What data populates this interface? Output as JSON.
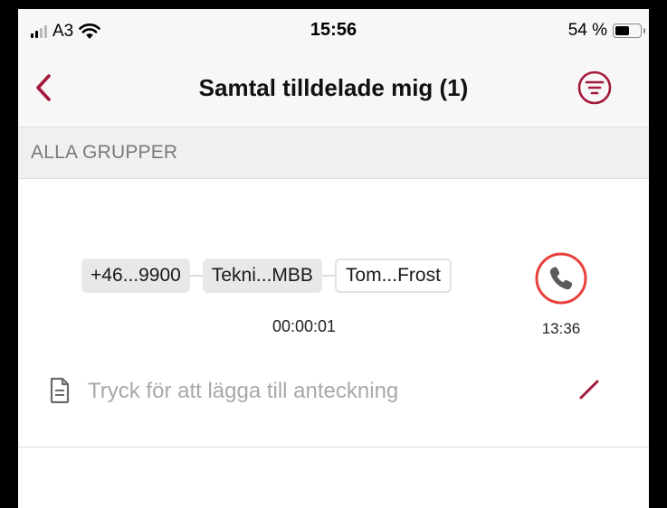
{
  "status_bar": {
    "carrier": "A3",
    "time": "15:56",
    "battery_percent": "54 %",
    "battery_level": 0.54
  },
  "nav": {
    "back_icon": "chevron-left-icon",
    "title": "Samtal tilldelade mig (1)",
    "filter_icon": "filter-icon"
  },
  "section": {
    "label": "ALLA GRUPPER"
  },
  "call": {
    "chain": [
      {
        "label": "+46...9900",
        "style": "filled"
      },
      {
        "label": "Tekni...MBB",
        "style": "filled"
      },
      {
        "label": "Tom...Frost",
        "style": "outlined"
      }
    ],
    "duration": "00:00:01",
    "call_icon": "phone-icon",
    "time": "13:36",
    "note_placeholder": "Tryck för att lägga till anteckning",
    "note_icon": "document-icon",
    "edit_icon": "pencil-icon"
  },
  "colors": {
    "accent": "#a3193a",
    "call_ring": "#e8403a"
  }
}
